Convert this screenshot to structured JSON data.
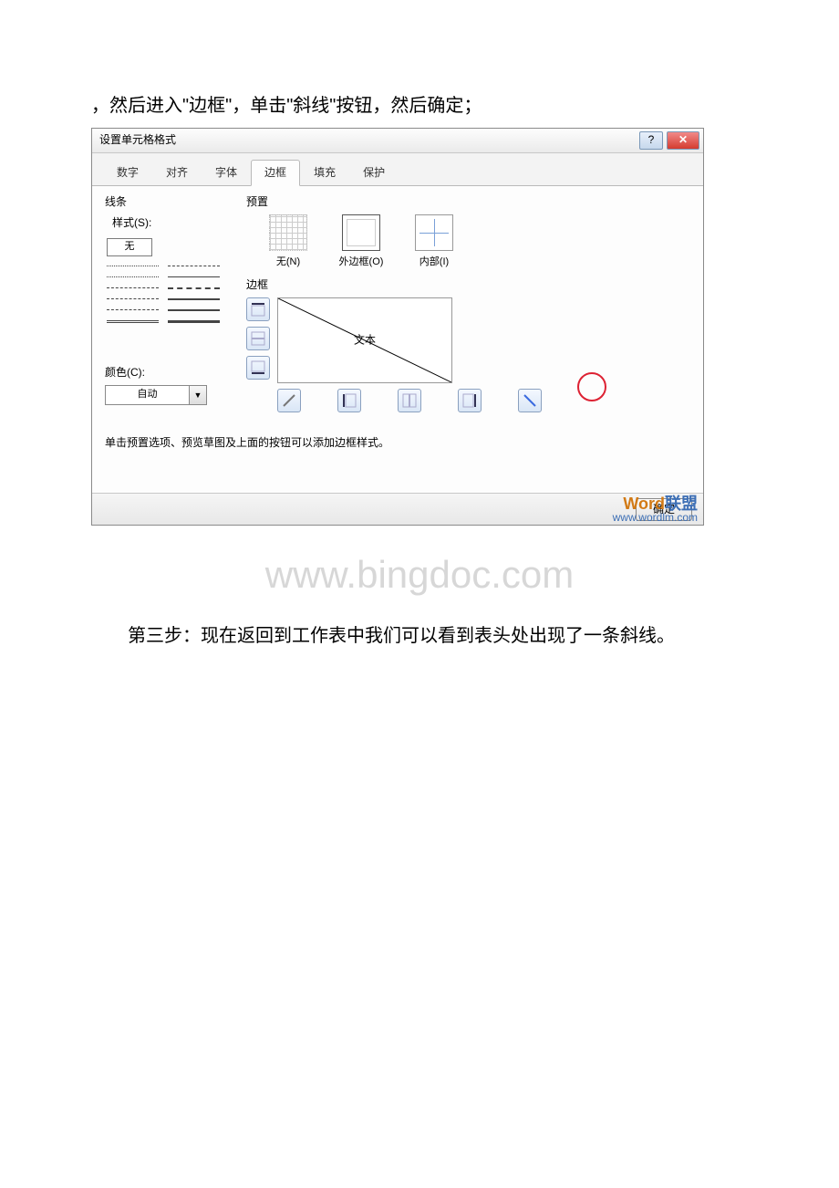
{
  "doc": {
    "intro": "，然后进入\"边框\"，单击\"斜线\"按钮，然后确定；",
    "page_watermark": "www.bingdoc.com",
    "step3": "第三步：现在返回到工作表中我们可以看到表头处出现了一条斜线。"
  },
  "dialog": {
    "title": "设置单元格格式",
    "help_glyph": "?",
    "close_glyph": "✕",
    "tabs": [
      "数字",
      "对齐",
      "字体",
      "边框",
      "填充",
      "保护"
    ],
    "active_tab_index": 3,
    "line_group": "线条",
    "style_label": "样式(S):",
    "style_none": "无",
    "color_label": "颜色(C):",
    "color_value": "自动",
    "preset_group": "预置",
    "presets": [
      {
        "label": "无(N)"
      },
      {
        "label": "外边框(O)"
      },
      {
        "label": "内部(I)"
      }
    ],
    "border_group": "边框",
    "preview_text": "文本",
    "hint": "单击预置选项、预览草图及上面的按钮可以添加边框样式。",
    "ok": "确定",
    "watermark": {
      "brand": "Word",
      "brand_cn": "联盟",
      "url": "www.wordlm.com"
    }
  }
}
